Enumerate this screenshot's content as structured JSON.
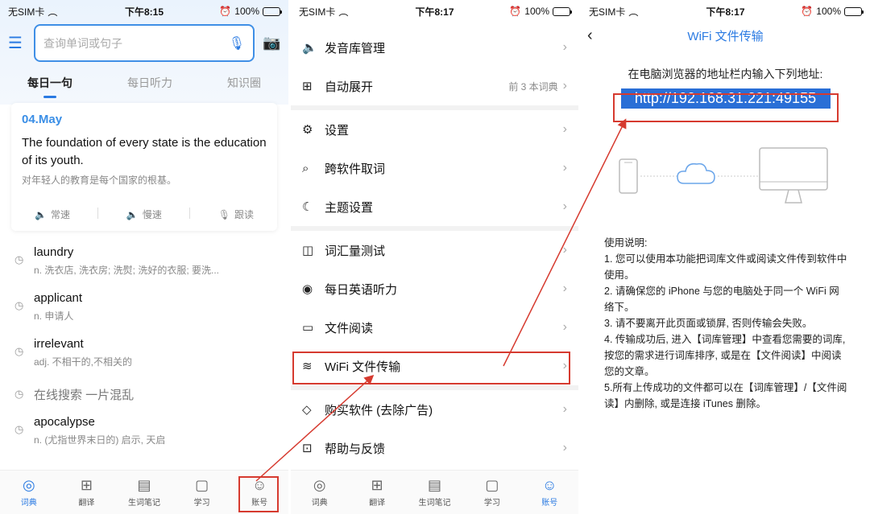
{
  "status": {
    "carrier": "无SIM卡",
    "battery": "100%",
    "times": [
      "下午8:15",
      "下午8:17",
      "下午8:17"
    ]
  },
  "screen1": {
    "search_placeholder": "查询单词或句子",
    "tabs": [
      {
        "label": "每日一句",
        "active": true
      },
      {
        "label": "每日听力",
        "active": false
      },
      {
        "label": "知识圈",
        "active": false
      }
    ],
    "card": {
      "date": "04.May",
      "sentence_en": "The foundation of every state is the education of its youth.",
      "sentence_cn": "对年轻人的教育是每个国家的根基。",
      "actions": [
        "常速",
        "慢速",
        "跟读"
      ]
    },
    "history": [
      {
        "word": "laundry",
        "def": "n. 洗衣店, 洗衣房; 洗熨; 洗好的衣服; 要洗..."
      },
      {
        "word": "applicant",
        "def": "n. 申请人"
      },
      {
        "word": "irrelevant",
        "def": "adj. 不相干的,不相关的"
      },
      {
        "word": "在线搜索 一片混乱",
        "def": ""
      },
      {
        "word": "apocalypse",
        "def": "n. (尤指世界末日的) 启示, 天启"
      }
    ]
  },
  "tabbar": [
    {
      "label": "词典",
      "icon": "search-icon"
    },
    {
      "label": "翻译",
      "icon": "translate-icon"
    },
    {
      "label": "生词笔记",
      "icon": "notebook-icon"
    },
    {
      "label": "学习",
      "icon": "book-icon"
    },
    {
      "label": "账号",
      "icon": "smiley-icon"
    }
  ],
  "screen2": {
    "groups": [
      [
        {
          "label": "发音库管理",
          "icon": "speaker-icon",
          "extra": ""
        },
        {
          "label": "自动展开",
          "icon": "expand-icon",
          "extra": "前 3 本词典"
        }
      ],
      [
        {
          "label": "设置",
          "icon": "gear-icon",
          "extra": ""
        },
        {
          "label": "跨软件取词",
          "icon": "lookup-icon",
          "extra": ""
        },
        {
          "label": "主题设置",
          "icon": "moon-icon",
          "extra": ""
        }
      ],
      [
        {
          "label": "词汇量测试",
          "icon": "chart-icon",
          "extra": ""
        },
        {
          "label": "每日英语听力",
          "icon": "listening-icon",
          "extra": ""
        },
        {
          "label": "文件阅读",
          "icon": "folder-icon",
          "extra": ""
        },
        {
          "label": "WiFi 文件传输",
          "icon": "wifi-icon",
          "extra": ""
        }
      ],
      [
        {
          "label": "购买软件 (去除广告)",
          "icon": "diamond-icon",
          "extra": ""
        },
        {
          "label": "帮助与反馈",
          "icon": "help-icon",
          "extra": ""
        }
      ]
    ]
  },
  "screen3": {
    "title": "WiFi 文件传输",
    "hint": "在电脑浏览器的地址栏内输入下列地址:",
    "url": "http://192.168.31.221:49155",
    "notes": [
      "使用说明:",
      "1. 您可以使用本功能把词库文件或阅读文件传到软件中使用。",
      "2. 请确保您的 iPhone 与您的电脑处于同一个 WiFi 网络下。",
      "3. 请不要离开此页面或锁屏, 否则传输会失败。",
      "4. 传输成功后, 进入【词库管理】中查看您需要的词库, 按您的需求进行词库排序, 或是在【文件阅读】中阅读您的文章。",
      "5.所有上传成功的文件都可以在【词库管理】/【文件阅读】内删除, 或是连接 iTunes 删除。"
    ]
  },
  "colors": {
    "accent": "#2a7ae2",
    "annotation": "#d63a2f"
  }
}
